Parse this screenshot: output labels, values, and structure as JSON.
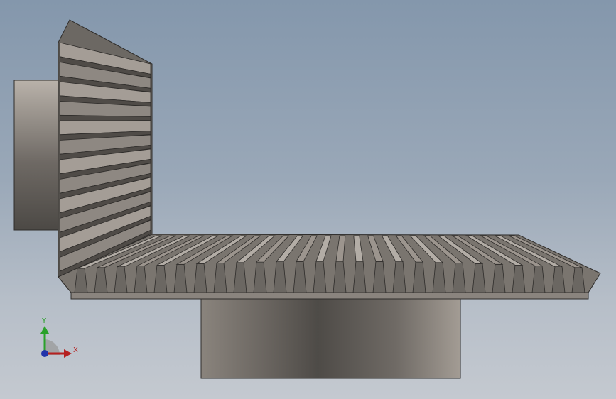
{
  "viewport": {
    "background_top": "#8497ac",
    "background_bottom": "#c4c9d0"
  },
  "model": {
    "parts": [
      "bevel-gear-vertical",
      "bevel-gear-horizontal",
      "left-hub",
      "bottom-hub"
    ],
    "gear_color_light": "#bdb6ae",
    "gear_color_dark": "#4f4b47"
  },
  "triad": {
    "y_label": "Y",
    "x_label": "X",
    "y_color": "#2aa12a",
    "x_color": "#b52020",
    "z_color": "#2233aa"
  }
}
